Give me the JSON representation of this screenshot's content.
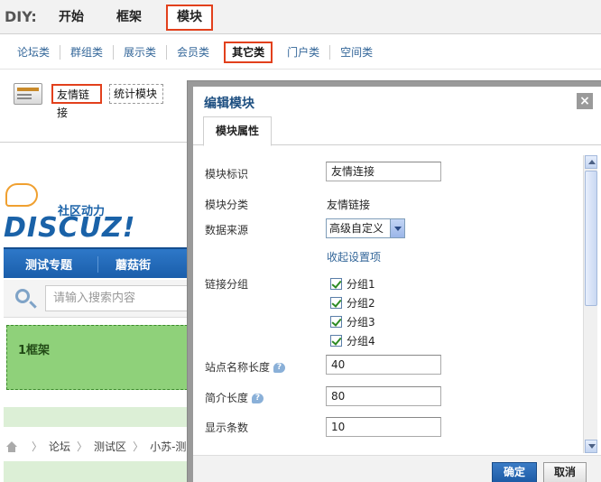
{
  "diy": {
    "label": "DIY:",
    "tabs": [
      {
        "label": "开始"
      },
      {
        "label": "框架"
      },
      {
        "label": "模块"
      }
    ]
  },
  "categories": {
    "items": [
      "论坛类",
      "群组类",
      "展示类",
      "会员类",
      "其它类",
      "门户类",
      "空间类"
    ],
    "active": "其它类"
  },
  "modules": {
    "items": [
      "友情链接",
      "统计模块"
    ],
    "selected": "友情链接"
  },
  "forum": {
    "logo_slogan": "社区动力",
    "logo_text": "DISCUZ!",
    "nav": [
      "测试专题",
      "蘑菇街"
    ],
    "search_placeholder": "请输入搜索内容",
    "frame_label": "1框架",
    "breadcrumb": [
      "论坛",
      "测试区",
      "小苏-测试"
    ]
  },
  "dialog": {
    "title": "编辑模块",
    "close": "×",
    "tab": "模块属性",
    "fields": {
      "module_id_label": "模块标识",
      "module_id_value": "友情连接",
      "module_category_label": "模块分类",
      "module_category_value": "友情链接",
      "data_source_label": "数据来源",
      "data_source_value": "高级自定义",
      "collapse_link": "收起设置项",
      "link_group_label": "链接分组",
      "groups": [
        "分组1",
        "分组2",
        "分组3",
        "分组4"
      ],
      "site_name_len_label": "站点名称长度",
      "site_name_len_value": "40",
      "intro_len_label": "简介长度",
      "intro_len_value": "80",
      "display_count_label": "显示条数",
      "display_count_value": "10"
    },
    "ok": "确定",
    "cancel": "取消"
  },
  "colors": {
    "highlight": "#e2401c",
    "nav_blue": "#1a5eab",
    "frame_green": "#8fd17a",
    "link": "#336699"
  },
  "icons": [
    "module-card-icon",
    "search-icon",
    "home-icon",
    "help-icon",
    "close-icon",
    "chevron-down-icon",
    "checkbox-checked-icon"
  ]
}
